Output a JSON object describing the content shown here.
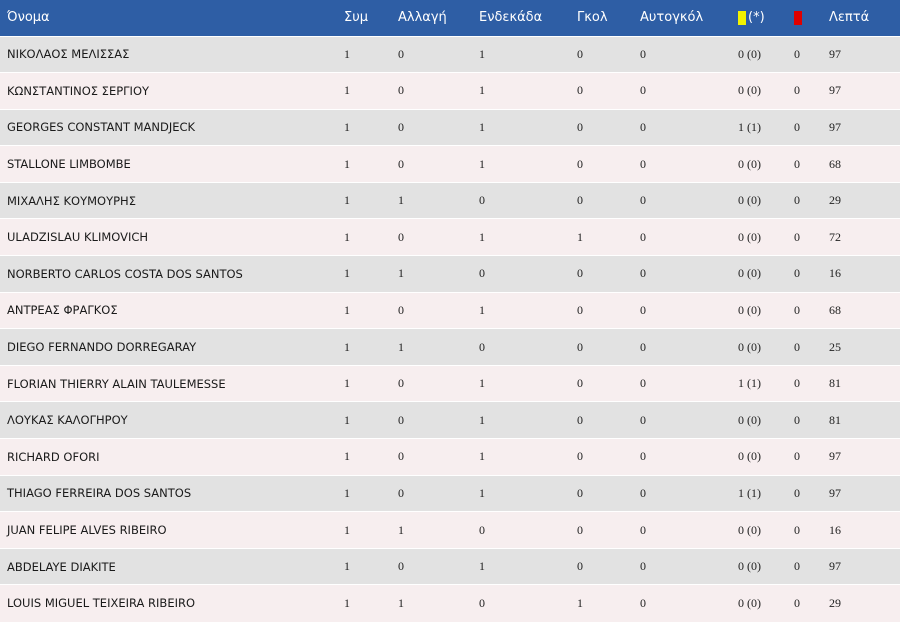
{
  "headers": {
    "name": "Όνομα",
    "appearances": "Συμ",
    "substitutions": "Αλλαγή",
    "starting": "Ενδεκάδα",
    "goals": "Γκολ",
    "own_goals": "Αυτογκόλ",
    "yellow_suffix": "(*)",
    "minutes": "Λεπτά"
  },
  "colors": {
    "header_bg": "#2e5ea5",
    "row_odd": "#e2e2e2",
    "row_even": "#f7eeef",
    "yellow_card": "#f3f300",
    "red_card": "#e00000"
  },
  "rows": [
    {
      "name": "ΝΙΚΟΛΑΟΣ ΜΕΛΙΣΣΑΣ",
      "app": "1",
      "sub": "0",
      "start": "1",
      "goals": "0",
      "own": "0",
      "yellow": "0 (0)",
      "red": "0",
      "min": "97"
    },
    {
      "name": "ΚΩΝΣΤΑΝΤΙΝΟΣ ΣΕΡΓΙΟΥ",
      "app": "1",
      "sub": "0",
      "start": "1",
      "goals": "0",
      "own": "0",
      "yellow": "0 (0)",
      "red": "0",
      "min": "97"
    },
    {
      "name": "GEORGES CONSTANT MANDJECK",
      "app": "1",
      "sub": "0",
      "start": "1",
      "goals": "0",
      "own": "0",
      "yellow": "1 (1)",
      "red": "0",
      "min": "97"
    },
    {
      "name": "STALLONE LIMBOMBE",
      "app": "1",
      "sub": "0",
      "start": "1",
      "goals": "0",
      "own": "0",
      "yellow": "0 (0)",
      "red": "0",
      "min": "68"
    },
    {
      "name": "ΜΙΧΑΛΗΣ ΚΟΥΜΟΥΡΗΣ",
      "app": "1",
      "sub": "1",
      "start": "0",
      "goals": "0",
      "own": "0",
      "yellow": "0 (0)",
      "red": "0",
      "min": "29"
    },
    {
      "name": "ULADZISLAU KLIMOVICH",
      "app": "1",
      "sub": "0",
      "start": "1",
      "goals": "1",
      "own": "0",
      "yellow": "0 (0)",
      "red": "0",
      "min": "72"
    },
    {
      "name": "NORBERTO CARLOS COSTA DOS SANTOS",
      "app": "1",
      "sub": "1",
      "start": "0",
      "goals": "0",
      "own": "0",
      "yellow": "0 (0)",
      "red": "0",
      "min": "16"
    },
    {
      "name": "ΑΝΤΡΕΑΣ ΦΡΑΓΚΟΣ",
      "app": "1",
      "sub": "0",
      "start": "1",
      "goals": "0",
      "own": "0",
      "yellow": "0 (0)",
      "red": "0",
      "min": "68"
    },
    {
      "name": "DIEGO FERNANDO DORREGARAY",
      "app": "1",
      "sub": "1",
      "start": "0",
      "goals": "0",
      "own": "0",
      "yellow": "0 (0)",
      "red": "0",
      "min": "25"
    },
    {
      "name": "FLORIAN THIERRY ALAIN TAULEMESSE",
      "app": "1",
      "sub": "0",
      "start": "1",
      "goals": "0",
      "own": "0",
      "yellow": "1 (1)",
      "red": "0",
      "min": "81"
    },
    {
      "name": "ΛΟΥΚΑΣ ΚΑΛΟΓΗΡΟΥ",
      "app": "1",
      "sub": "0",
      "start": "1",
      "goals": "0",
      "own": "0",
      "yellow": "0 (0)",
      "red": "0",
      "min": "81"
    },
    {
      "name": "RICHARD OFORI",
      "app": "1",
      "sub": "0",
      "start": "1",
      "goals": "0",
      "own": "0",
      "yellow": "0 (0)",
      "red": "0",
      "min": "97"
    },
    {
      "name": "THIAGO FERREIRA DOS SANTOS",
      "app": "1",
      "sub": "0",
      "start": "1",
      "goals": "0",
      "own": "0",
      "yellow": "1 (1)",
      "red": "0",
      "min": "97"
    },
    {
      "name": "JUAN FELIPE ALVES RIBEIRO",
      "app": "1",
      "sub": "1",
      "start": "0",
      "goals": "0",
      "own": "0",
      "yellow": "0 (0)",
      "red": "0",
      "min": "16"
    },
    {
      "name": "ABDELAYE DIAKITE",
      "app": "1",
      "sub": "0",
      "start": "1",
      "goals": "0",
      "own": "0",
      "yellow": "0 (0)",
      "red": "0",
      "min": "97"
    },
    {
      "name": "LOUIS MIGUEL TEIXEIRA RIBEIRO",
      "app": "1",
      "sub": "1",
      "start": "0",
      "goals": "1",
      "own": "0",
      "yellow": "0 (0)",
      "red": "0",
      "min": "29"
    }
  ]
}
